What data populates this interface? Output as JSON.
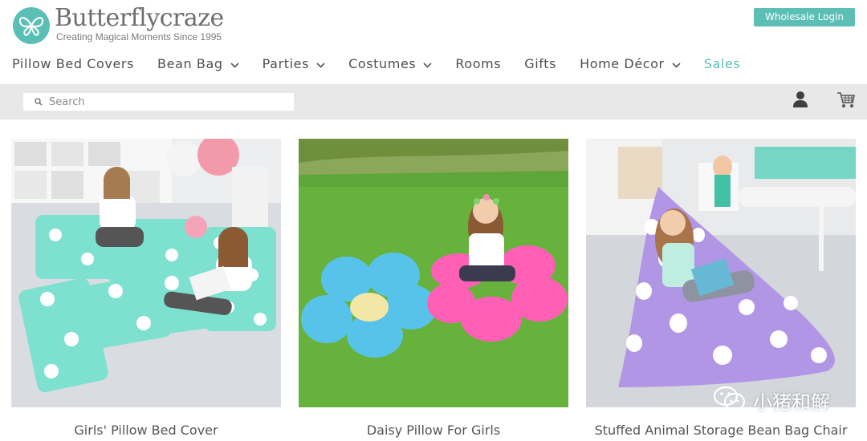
{
  "brand": {
    "name": "Butterflycraze",
    "tagline": "Creating Magical Moments Since 1995",
    "accent_color": "#5bbfb5"
  },
  "header": {
    "wholesale_label": "Wholesale Login"
  },
  "nav": {
    "items": [
      {
        "label": "Pillow Bed Covers",
        "dropdown": false
      },
      {
        "label": "Bean Bag",
        "dropdown": true
      },
      {
        "label": "Parties",
        "dropdown": true
      },
      {
        "label": "Costumes",
        "dropdown": true
      },
      {
        "label": "Rooms",
        "dropdown": false
      },
      {
        "label": "Gifts",
        "dropdown": false
      },
      {
        "label": "Home Décor",
        "dropdown": true
      },
      {
        "label": "Sales",
        "dropdown": false,
        "highlight": true
      }
    ]
  },
  "search": {
    "placeholder": "Search",
    "icon": "search-icon"
  },
  "toolbar_icons": [
    "user-icon",
    "cart-icon"
  ],
  "products": [
    {
      "title": "Girls' Pillow Bed Cover"
    },
    {
      "title": "Daisy Pillow For Girls"
    },
    {
      "title": "Stuffed Animal Storage Bean Bag Chair"
    }
  ],
  "watermark": {
    "text": "小猪和解",
    "icon": "wechat-icon"
  }
}
